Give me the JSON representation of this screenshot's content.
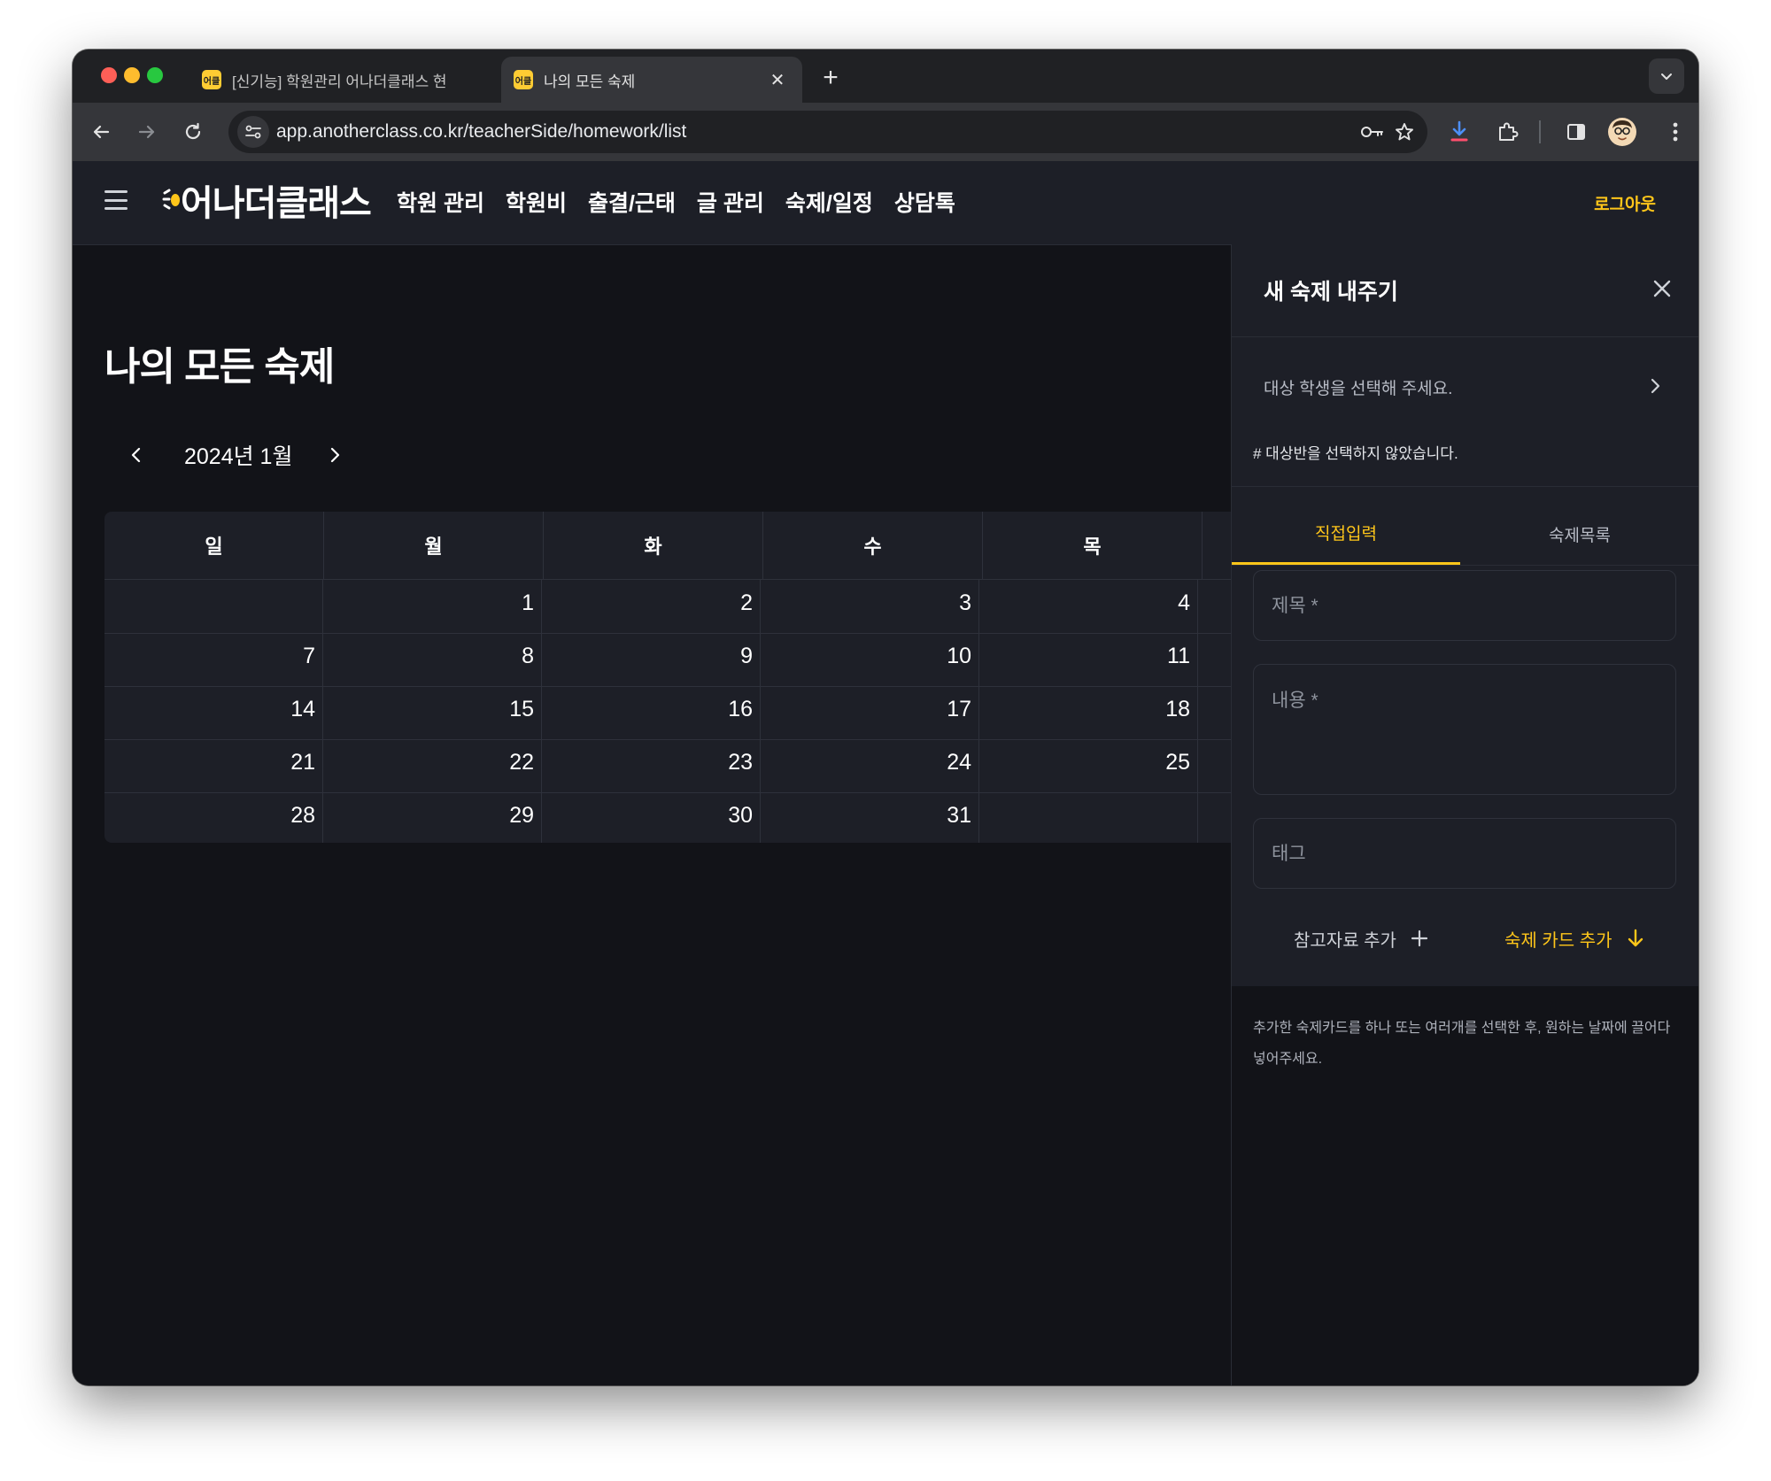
{
  "browser": {
    "tabs": [
      {
        "title": "[신기능] 학원관리 어나더클래스 현",
        "favicon": "어클"
      },
      {
        "title": "나의 모든 숙제",
        "favicon": "어클",
        "active": true
      }
    ],
    "url": "app.anotherclass.co.kr/teacherSide/homework/list"
  },
  "header": {
    "logo": "어나더클래스",
    "nav": [
      "학원 관리",
      "학원비",
      "출결/근태",
      "글 관리",
      "숙제/일정",
      "상담톡"
    ],
    "logout": "로그아웃"
  },
  "main": {
    "title": "나의 모든 숙제",
    "month": "2024년 1월",
    "weekdays": [
      "일",
      "월",
      "화",
      "수",
      "목",
      ""
    ],
    "weeks": [
      [
        "",
        "1",
        "2",
        "3",
        "4",
        ""
      ],
      [
        "7",
        "8",
        "9",
        "10",
        "11",
        ""
      ],
      [
        "14",
        "15",
        "16",
        "17",
        "18",
        ""
      ],
      [
        "21",
        "22",
        "23",
        "24",
        "25",
        ""
      ],
      [
        "28",
        "29",
        "30",
        "31",
        "",
        ""
      ]
    ]
  },
  "panel": {
    "title": "새 숙제 내주기",
    "student_select": "대상 학생을 선택해 주세요.",
    "class_note": "# 대상반을 선택하지 않았습니다.",
    "tabs": [
      "직접입력",
      "숙제목록"
    ],
    "title_placeholder": "제목 *",
    "content_placeholder": "내용 *",
    "tag_placeholder": "태그",
    "add_reference": "참고자료 추가",
    "add_card": "숙제 카드 추가",
    "hint": "추가한 숙제카드를 하나 또는 여러개를 선택한 후, 원하는 날짜에 끌어다 넣어주세요."
  },
  "colors": {
    "accent": "#ffc61a",
    "background": "#121318",
    "surface": "#1d1f27",
    "border": "#2e313b"
  }
}
